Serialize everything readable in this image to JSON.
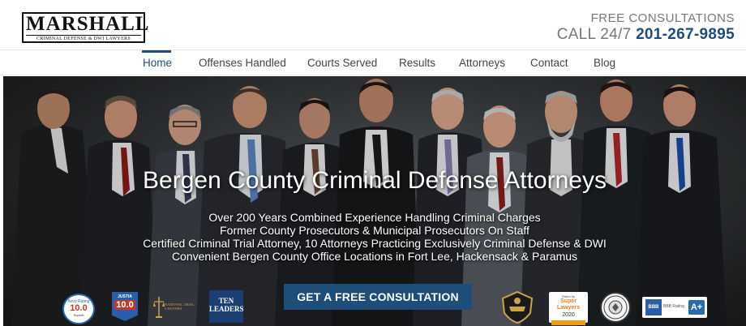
{
  "logo": {
    "name": "MARSHALL",
    "tagline": "CRIMINAL DEFENSE & DWI LAWYERS"
  },
  "contact": {
    "line1": "FREE CONSULTATIONS",
    "call_prefix": "CALL 24/7",
    "phone": "201-267-9895"
  },
  "nav": {
    "items": [
      "Home",
      "Offenses Handled",
      "Courts Served",
      "Results",
      "Attorneys",
      "Contact",
      "Blog"
    ],
    "active": "Home"
  },
  "hero": {
    "title": "Bergen County Criminal Defense Attorneys",
    "lines": [
      "Over 200 Years Combined Experience Handling Criminal Charges",
      "Former County Prosecutors & Municipal Prosecutors On Staff",
      "Certified Criminal Trial Attorney, 10 Attorneys Practicing Exclusively Criminal Defense & DWI",
      "Convenient Bergen County Office Locations in Fort Lee, Hackensack & Paramus"
    ],
    "cta_label": "GET A FREE CONSULTATION"
  },
  "badges": {
    "avvo": {
      "label": "Avvo Rating",
      "score": "10.0",
      "sub": "Superb"
    },
    "justia": {
      "label": "JUSTIA",
      "score": "10.0"
    },
    "ntl": {
      "text": "NATIONAL TRIAL LAWYERS"
    },
    "ten": {
      "line1": "TEN",
      "line2": "LEADERS"
    },
    "super_lawyers": {
      "top": "Rated by",
      "name": "Super Lawyers",
      "year": "2020"
    },
    "bbb": {
      "logo": "BBB",
      "text": "BBB Rating",
      "grade": "A+"
    }
  },
  "colors": {
    "brand": "#1f4d7a",
    "nav_text": "#444444",
    "contact_gray": "#777777"
  }
}
